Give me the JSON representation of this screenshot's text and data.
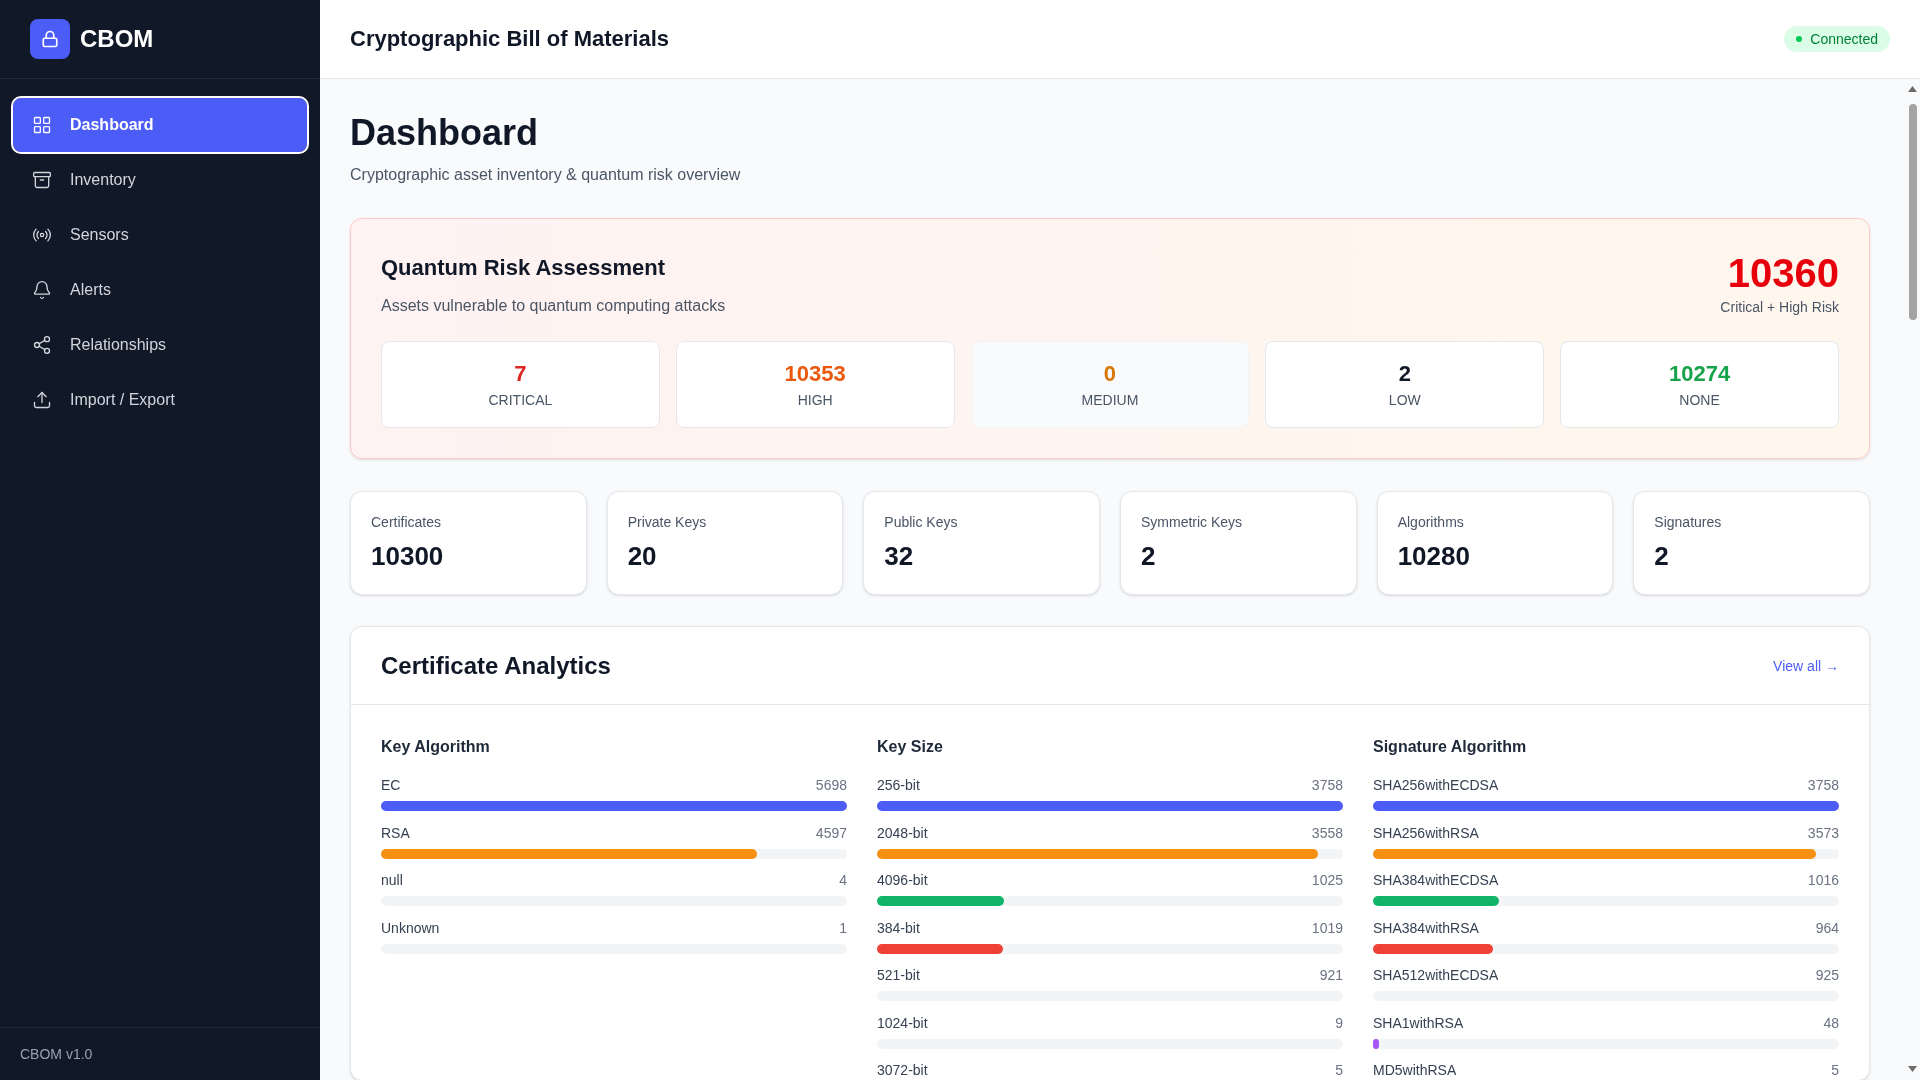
{
  "sidebar": {
    "brand": "CBOM",
    "items": [
      {
        "label": "Dashboard",
        "selected": true
      },
      {
        "label": "Inventory",
        "selected": false
      },
      {
        "label": "Sensors",
        "selected": false
      },
      {
        "label": "Alerts",
        "selected": false
      },
      {
        "label": "Relationships",
        "selected": false
      },
      {
        "label": "Import / Export",
        "selected": false
      }
    ],
    "footer": "CBOM v1.0"
  },
  "header": {
    "title": "Cryptographic Bill of Materials",
    "status": {
      "label": "Connected",
      "online": true
    }
  },
  "page": {
    "title": "Dashboard",
    "subtitle": "Cryptographic asset inventory & quantum risk overview"
  },
  "risk": {
    "title": "Quantum Risk Assessment",
    "subtitle": "Assets vulnerable to quantum computing attacks",
    "total": "10360",
    "total_label": "Critical + High Risk",
    "levels": [
      {
        "count": "7",
        "label": "CRITICAL",
        "color": "#dc2626",
        "muted": false
      },
      {
        "count": "10353",
        "label": "HIGH",
        "color": "#ea580c",
        "muted": false
      },
      {
        "count": "0",
        "label": "MEDIUM",
        "color": "#d97706",
        "muted": true
      },
      {
        "count": "2",
        "label": "LOW",
        "color": "#111827",
        "muted": false
      },
      {
        "count": "10274",
        "label": "NONE",
        "color": "#16a34a",
        "muted": false
      }
    ]
  },
  "stats": [
    {
      "label": "Certificates",
      "value": "10300"
    },
    {
      "label": "Private Keys",
      "value": "20"
    },
    {
      "label": "Public Keys",
      "value": "32"
    },
    {
      "label": "Symmetric Keys",
      "value": "2"
    },
    {
      "label": "Algorithms",
      "value": "10280"
    },
    {
      "label": "Signatures",
      "value": "2"
    }
  ],
  "analytics": {
    "title": "Certificate Analytics",
    "link": "View all →",
    "groups": [
      {
        "title": "Key Algorithm",
        "rows": [
          {
            "kind": "bar",
            "label": "EC",
            "value": "5698",
            "level": 1,
            "color": "#4c5cf6"
          },
          {
            "kind": "bar",
            "label": "RSA",
            "value": "4597",
            "level": 0.807,
            "color": "#f59011"
          },
          {
            "kind": "bar",
            "label": "null",
            "value": "4"
          },
          {
            "kind": "bar",
            "label": "Unknown",
            "value": "1"
          }
        ]
      },
      {
        "title": "Key Size",
        "rows": [
          {
            "kind": "bar",
            "label": "256-bit",
            "value": "3758",
            "level": 1,
            "color": "#4c5cf6"
          },
          {
            "kind": "bar",
            "label": "2048-bit",
            "value": "3558",
            "level": 0.947,
            "color": "#f59011"
          },
          {
            "kind": "bar",
            "label": "4096-bit",
            "value": "1025",
            "level": 0.273,
            "color": "#10b56a"
          },
          {
            "kind": "bar",
            "label": "384-bit",
            "value": "1019",
            "level": 0.271,
            "color": "#ef4136"
          },
          {
            "kind": "bar",
            "label": "521-bit",
            "value": "921"
          },
          {
            "kind": "bar",
            "label": "1024-bit",
            "value": "9"
          },
          {
            "kind": "text",
            "label": "3072-bit",
            "value": "5"
          }
        ]
      },
      {
        "title": "Signature Algorithm",
        "rows": [
          {
            "kind": "bar",
            "label": "SHA256withECDSA",
            "value": "3758",
            "level": 1,
            "color": "#4c5cf6"
          },
          {
            "kind": "bar",
            "label": "SHA256withRSA",
            "value": "3573",
            "level": 0.951,
            "color": "#f59011"
          },
          {
            "kind": "bar",
            "label": "SHA384withECDSA",
            "value": "1016",
            "level": 0.27,
            "color": "#10b56a"
          },
          {
            "kind": "bar",
            "label": "SHA384withRSA",
            "value": "964",
            "level": 0.257,
            "color": "#ef4136"
          },
          {
            "kind": "bar",
            "label": "SHA512withECDSA",
            "value": "925"
          },
          {
            "kind": "bar",
            "label": "SHA1withRSA",
            "value": "48",
            "level": 0.01,
            "color": "#a855f7"
          },
          {
            "kind": "text",
            "label": "MD5withRSA",
            "value": "5"
          }
        ]
      }
    ]
  }
}
